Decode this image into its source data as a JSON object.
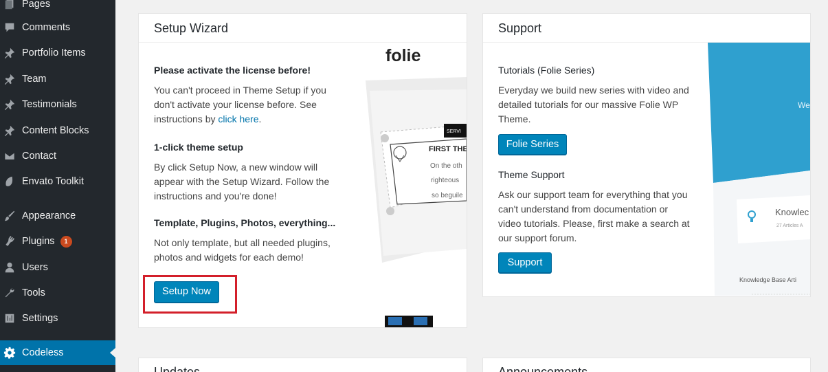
{
  "sidebar": {
    "items": [
      {
        "label": "Pages",
        "icon": "pages-icon"
      },
      {
        "label": "Comments",
        "icon": "comments-icon"
      },
      {
        "label": "Portfolio Items",
        "icon": "pin-icon"
      },
      {
        "label": "Team",
        "icon": "pin-icon"
      },
      {
        "label": "Testimonials",
        "icon": "pin-icon"
      },
      {
        "label": "Content Blocks",
        "icon": "pin-icon"
      },
      {
        "label": "Contact",
        "icon": "mail-icon"
      },
      {
        "label": "Envato Toolkit",
        "icon": "leaf-icon"
      },
      {
        "label": "Appearance",
        "icon": "brush-icon"
      },
      {
        "label": "Plugins",
        "icon": "plug-icon",
        "badge": "1"
      },
      {
        "label": "Users",
        "icon": "user-icon"
      },
      {
        "label": "Tools",
        "icon": "wrench-icon"
      },
      {
        "label": "Settings",
        "icon": "settings-icon"
      },
      {
        "label": "Codeless",
        "icon": "gear-icon",
        "active": true
      }
    ]
  },
  "setup": {
    "title": "Setup Wizard",
    "h1": "Please activate the license before!",
    "p1a": "You can't proceed in Theme Setup if you",
    "p1b": "don't activate your license before. See",
    "p1c": "instructions by ",
    "p1link": "click here",
    "p1end": ".",
    "h2": "1-click theme setup",
    "p2a": "By click Setup Now, a new window will",
    "p2b": "appear with the Setup Wizard. Follow the",
    "p2c": "instructions and you're done!",
    "h3": "Template, Plugins, Photos, everything...",
    "p3a": "Not only template, but all needed plugins,",
    "p3b": "photos and widgets for each demo!",
    "button": "Setup Now",
    "preview": {
      "brand": "folie",
      "tag": "SERVI",
      "heading": "FIRST THE",
      "l1": "On the oth",
      "l2": "righteous",
      "l3": "so beguile"
    }
  },
  "support": {
    "title": "Support",
    "h1": "Tutorials (Folie Series)",
    "p1a": "Everyday we build new series with video and",
    "p1b": "detailed tutorials for our massive Folie WP",
    "p1c": "Theme.",
    "button1": "Folie Series",
    "h2": "Theme Support",
    "p2a": "Ask our support team for everything that you",
    "p2b": "can't understand from documentation or",
    "p2c": "video tutorials. Please, first make a search at",
    "p2d": "our support forum.",
    "button2": "Support",
    "preview": {
      "hero": "We",
      "kb_title": "Knowlec",
      "kb_sub": "27 Articles A",
      "kb_footer": "Knowledge Base Arti"
    }
  },
  "lower": {
    "updates": "Updates",
    "announcements": "Announcements"
  },
  "colors": {
    "accent": "#0073aa",
    "button": "#0085ba",
    "highlight": "#d31f2a",
    "sidebar": "#23282d"
  }
}
